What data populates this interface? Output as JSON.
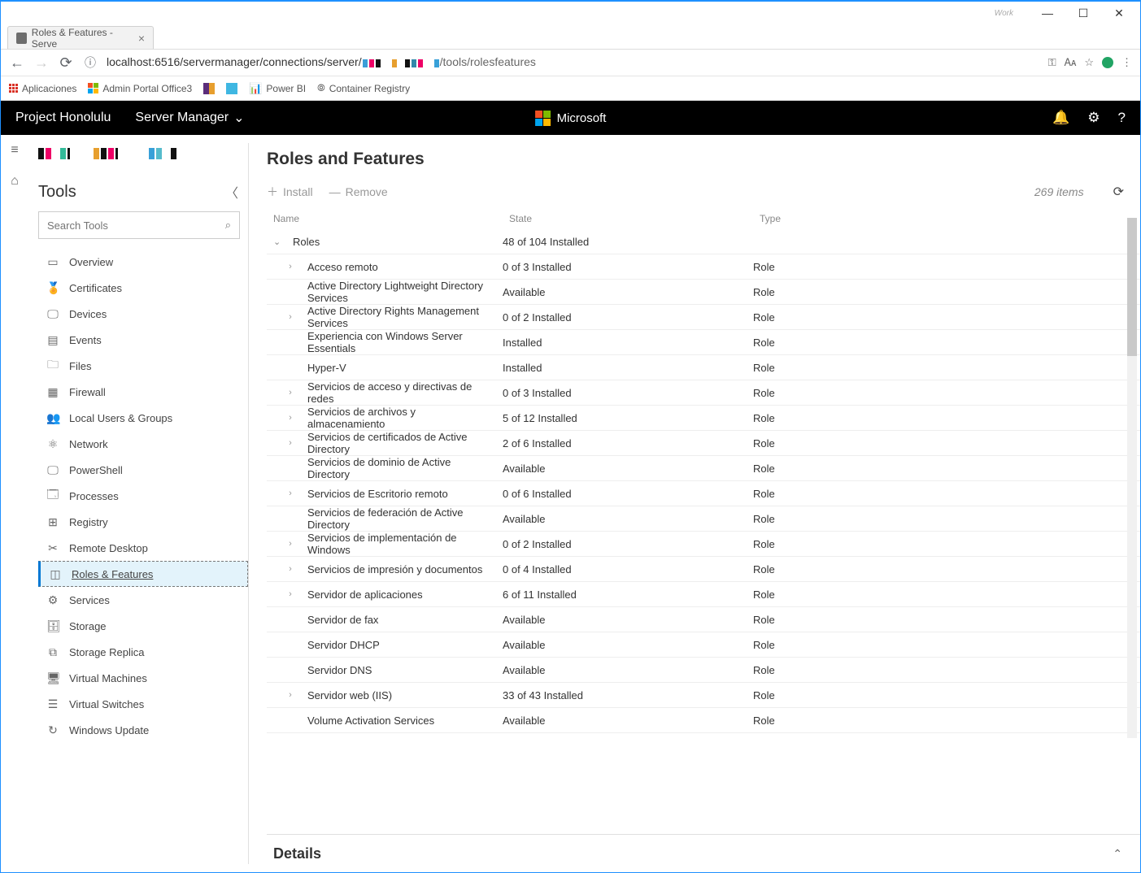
{
  "window": {
    "watermark": "Work",
    "minimize": "—",
    "maximize": "☐",
    "close": "✕"
  },
  "browser": {
    "tab_title": "Roles & Features - Serve",
    "url_prefix": "localhost:6516/servermanager/connections/server/",
    "url_suffix": "/tools/rolesfeatures",
    "bookmarks": {
      "apps": "Aplicaciones",
      "admin": "Admin Portal Office3",
      "powerbi": "Power BI",
      "container": "Container Registry"
    }
  },
  "header": {
    "brand": "Project Honolulu",
    "section": "Server Manager",
    "ms": "Microsoft"
  },
  "sidebar": {
    "title": "Tools",
    "search_placeholder": "Search Tools",
    "items": [
      {
        "icon": "▭",
        "label": "Overview"
      },
      {
        "icon": "🏅",
        "label": "Certificates"
      },
      {
        "icon": "🖵",
        "label": "Devices"
      },
      {
        "icon": "▤",
        "label": "Events"
      },
      {
        "icon": "🗀",
        "label": "Files"
      },
      {
        "icon": "▦",
        "label": "Firewall"
      },
      {
        "icon": "👥",
        "label": "Local Users & Groups"
      },
      {
        "icon": "⚛",
        "label": "Network"
      },
      {
        "icon": "🖵",
        "label": "PowerShell"
      },
      {
        "icon": "🗔",
        "label": "Processes"
      },
      {
        "icon": "⊞",
        "label": "Registry"
      },
      {
        "icon": "✂",
        "label": "Remote Desktop"
      },
      {
        "icon": "◫",
        "label": "Roles & Features"
      },
      {
        "icon": "⚙",
        "label": "Services"
      },
      {
        "icon": "🗄",
        "label": "Storage"
      },
      {
        "icon": "⧉",
        "label": "Storage Replica"
      },
      {
        "icon": "🖥",
        "label": "Virtual Machines"
      },
      {
        "icon": "☰",
        "label": "Virtual Switches"
      },
      {
        "icon": "↻",
        "label": "Windows Update"
      }
    ],
    "selected": 12
  },
  "content": {
    "title": "Roles and Features",
    "install": "Install",
    "remove": "Remove",
    "count": "269 items",
    "columns": {
      "name": "Name",
      "state": "State",
      "type": "Type"
    },
    "group": {
      "name": "Roles",
      "state": "48 of 104 Installed"
    },
    "rows": [
      {
        "exp": true,
        "name": "Acceso remoto",
        "state": "0 of 3 Installed",
        "type": "Role"
      },
      {
        "exp": false,
        "name": "Active Directory Lightweight Directory Services",
        "state": "Available",
        "type": "Role"
      },
      {
        "exp": true,
        "name": "Active Directory Rights Management Services",
        "state": "0 of 2 Installed",
        "type": "Role"
      },
      {
        "exp": false,
        "name": "Experiencia con Windows Server Essentials",
        "state": "Installed",
        "type": "Role"
      },
      {
        "exp": false,
        "name": "Hyper-V",
        "state": "Installed",
        "type": "Role"
      },
      {
        "exp": true,
        "name": "Servicios de acceso y directivas de redes",
        "state": "0 of 3 Installed",
        "type": "Role"
      },
      {
        "exp": true,
        "name": "Servicios de archivos y almacenamiento",
        "state": "5 of 12 Installed",
        "type": "Role"
      },
      {
        "exp": true,
        "name": "Servicios de certificados de Active Directory",
        "state": "2 of 6 Installed",
        "type": "Role"
      },
      {
        "exp": false,
        "name": "Servicios de dominio de Active Directory",
        "state": "Available",
        "type": "Role"
      },
      {
        "exp": true,
        "name": "Servicios de Escritorio remoto",
        "state": "0 of 6 Installed",
        "type": "Role"
      },
      {
        "exp": false,
        "name": "Servicios de federación de Active Directory",
        "state": "Available",
        "type": "Role"
      },
      {
        "exp": true,
        "name": "Servicios de implementación de Windows",
        "state": "0 of 2 Installed",
        "type": "Role"
      },
      {
        "exp": true,
        "name": "Servicios de impresión y documentos",
        "state": "0 of 4 Installed",
        "type": "Role"
      },
      {
        "exp": true,
        "name": "Servidor de aplicaciones",
        "state": "6 of 11 Installed",
        "type": "Role"
      },
      {
        "exp": false,
        "name": "Servidor de fax",
        "state": "Available",
        "type": "Role"
      },
      {
        "exp": false,
        "name": "Servidor DHCP",
        "state": "Available",
        "type": "Role"
      },
      {
        "exp": false,
        "name": "Servidor DNS",
        "state": "Available",
        "type": "Role"
      },
      {
        "exp": true,
        "name": "Servidor web (IIS)",
        "state": "33 of 43 Installed",
        "type": "Role"
      },
      {
        "exp": false,
        "name": "Volume Activation Services",
        "state": "Available",
        "type": "Role"
      }
    ],
    "details": "Details"
  }
}
